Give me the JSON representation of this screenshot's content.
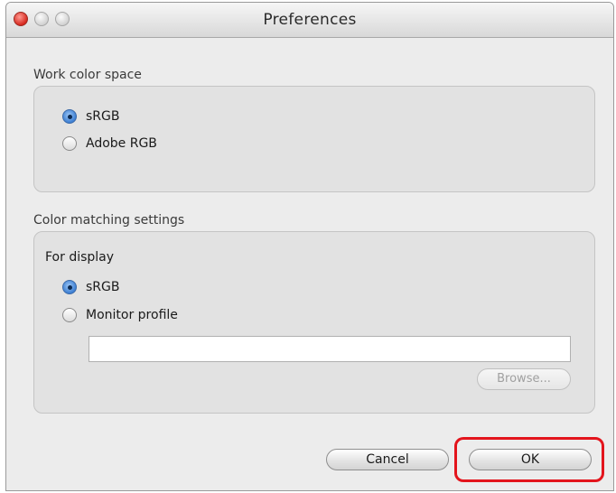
{
  "window": {
    "title": "Preferences"
  },
  "work_color_space": {
    "caption": "Work color space",
    "options": [
      {
        "label": "sRGB",
        "selected": true
      },
      {
        "label": "Adobe RGB",
        "selected": false
      }
    ]
  },
  "color_matching": {
    "caption": "Color matching settings",
    "for_display_label": "For display",
    "options": [
      {
        "label": "sRGB",
        "selected": true
      },
      {
        "label": "Monitor profile",
        "selected": false
      }
    ],
    "profile_path": "",
    "browse_label": "Browse...",
    "browse_enabled": false
  },
  "buttons": {
    "cancel_label": "Cancel",
    "ok_label": "OK"
  },
  "colors": {
    "highlight": "#e3141c",
    "radio_selected": "#3d7fd3"
  }
}
